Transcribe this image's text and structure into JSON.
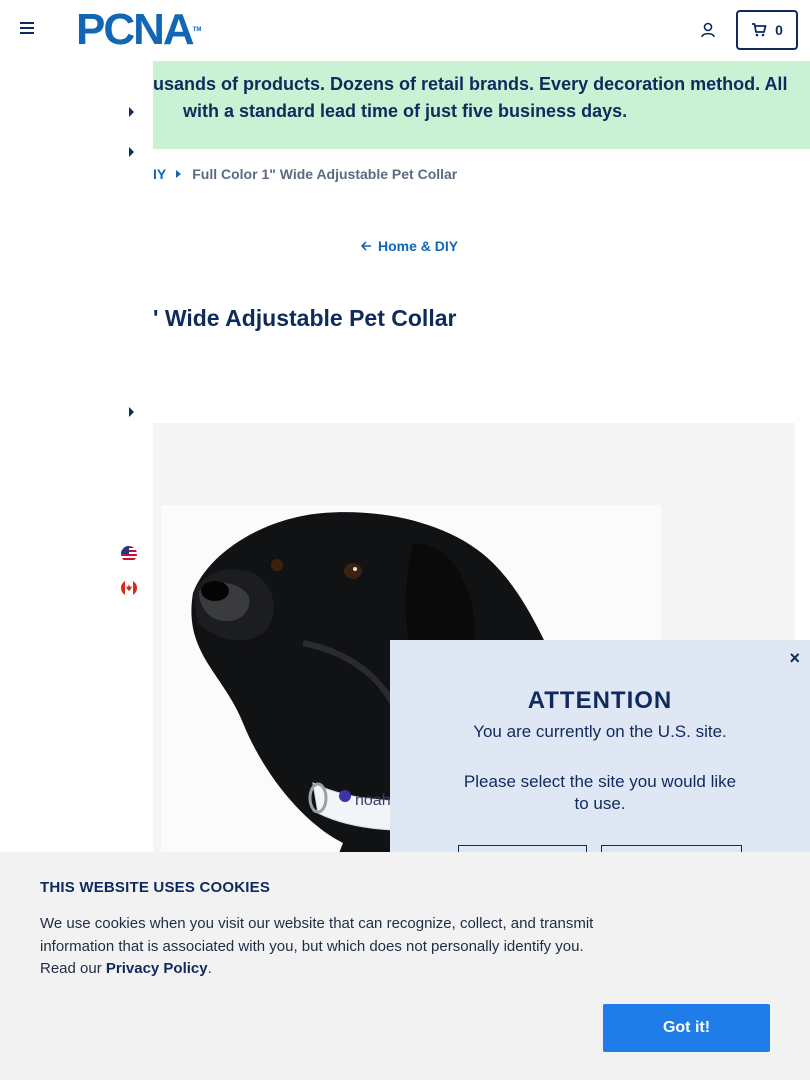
{
  "header": {
    "logo_text": "PCNA",
    "logo_tm": "TM",
    "cart_count": "0"
  },
  "banner": {
    "line1": "usands of products. Dozens of retail brands. Every decoration method. All",
    "line2": "with a standard lead time of just five business days."
  },
  "breadcrumb": {
    "parent": "IY",
    "current": "Full Color 1\" Wide Adjustable Pet Collar"
  },
  "back_link": "Home & DIY",
  "product": {
    "title": "' Wide Adjustable Pet Collar",
    "collar_imprint": "noah"
  },
  "modal": {
    "close": "×",
    "title": "ATTENTION",
    "text1": "You are currently on the U.S. site.",
    "text2": "Please select the site you would like to use."
  },
  "cookie": {
    "title": "THIS WEBSITE USES COOKIES",
    "text_before": "We use cookies when you visit our website that can recognize, collect, and transmit information that is associated with you, but which does not personally identify you. Read our ",
    "link": "Privacy Policy",
    "text_after": ".",
    "button": "Got it!"
  },
  "colors": {
    "navy": "#0f2a5c",
    "brand_blue": "#1267b4",
    "banner_green": "#c9f2d4",
    "modal_bg": "#dfe7f5",
    "cookie_bg": "#f2f2f2",
    "cta_blue": "#1f7dea"
  }
}
